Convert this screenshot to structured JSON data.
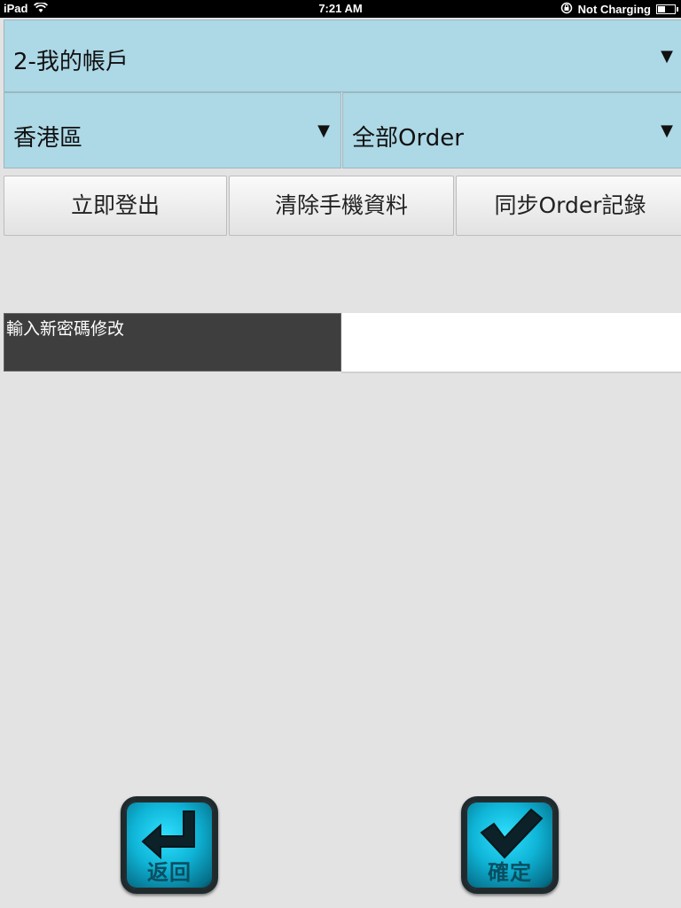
{
  "status_bar": {
    "device": "iPad",
    "time": "7:21 AM",
    "charging": "Not Charging",
    "icons": [
      "wifi-icon",
      "rotation-lock-icon",
      "battery-icon"
    ]
  },
  "account_select": {
    "value": "2-我的帳戶"
  },
  "region_select": {
    "value": "香港區"
  },
  "order_select": {
    "value": "全部Order"
  },
  "dropdown_arrow": "▼",
  "actions": {
    "logout": "立即登出",
    "clear_data": "清除手機資料",
    "sync_orders": "同步Order記錄"
  },
  "password": {
    "label": "輸入新密碼修改",
    "value": ""
  },
  "bottom": {
    "back_label": "返回",
    "back_icon": "return-arrow-icon",
    "confirm_label": "確定",
    "confirm_icon": "checkmark-icon"
  },
  "colors": {
    "select_bg": "#add8e6",
    "label_bg": "#3e3e3e",
    "page_bg": "#e3e3e3",
    "icon_button": "#0fb4d6"
  }
}
